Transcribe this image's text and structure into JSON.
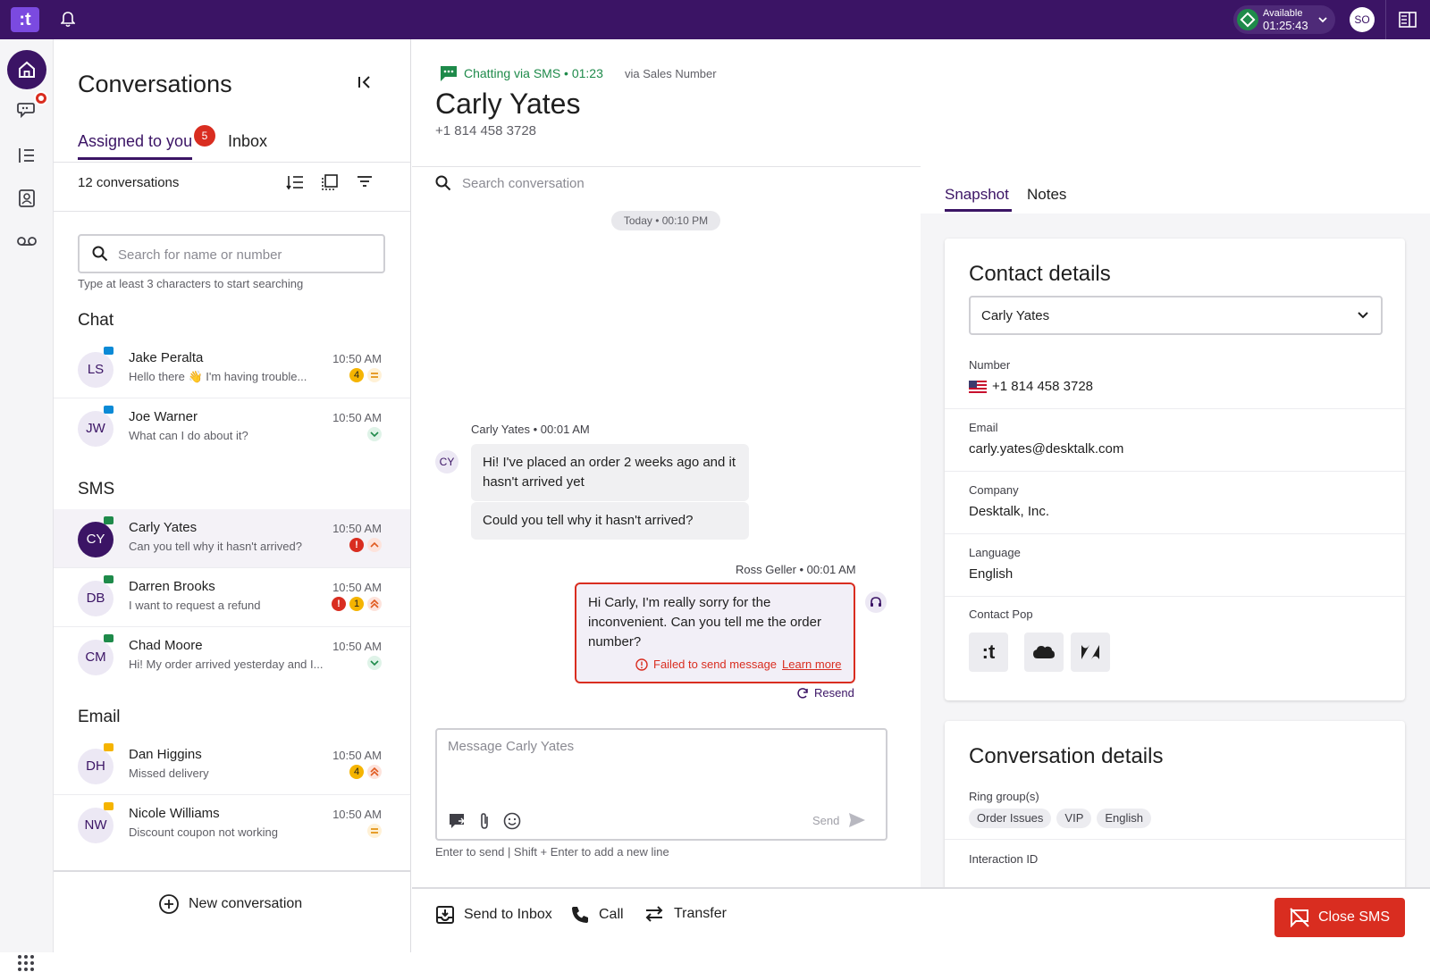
{
  "topbar": {
    "logo": ":t",
    "status": {
      "label": "Available",
      "timer": "01:25:43",
      "color": "#1e8a4a"
    },
    "user_initials": "SO",
    "brand_color": "#3b1465"
  },
  "nav": {
    "items": [
      {
        "name": "home-icon",
        "active": true
      },
      {
        "name": "conversations-icon",
        "badge": true
      },
      {
        "name": "list-icon"
      },
      {
        "name": "contacts-icon"
      },
      {
        "name": "voicemail-icon"
      }
    ]
  },
  "conversations": {
    "title": "Conversations",
    "tabs": [
      {
        "label": "Assigned to you",
        "badge": "5",
        "active": true
      },
      {
        "label": "Inbox"
      }
    ],
    "count_label": "12 conversations",
    "search": {
      "placeholder": "Search for name or number",
      "hint": "Type at least 3 characters to start searching"
    },
    "sections": [
      {
        "title": "Chat",
        "items": [
          {
            "initials": "LS",
            "name": "Jake Peralta",
            "preview": "Hello there 👋 I'm having trouble...",
            "time": "10:50 AM",
            "count": "4",
            "priority": "medium",
            "channel": "chat"
          },
          {
            "initials": "JW",
            "name": "Joe Warner",
            "preview": "What can I do about it?",
            "time": "10:50 AM",
            "priority": "low",
            "channel": "chat"
          }
        ]
      },
      {
        "title": "SMS",
        "items": [
          {
            "initials": "CY",
            "name": "Carly Yates",
            "preview": "Can you tell why it hasn't arrived?",
            "time": "10:50 AM",
            "error": "!",
            "priority": "high",
            "channel": "sms",
            "selected": true
          },
          {
            "initials": "DB",
            "name": "Darren Brooks",
            "preview": "I want to request a refund",
            "time": "10:50 AM",
            "error": "!",
            "count": "1",
            "priority": "urgent",
            "channel": "sms"
          },
          {
            "initials": "CM",
            "name": "Chad Moore",
            "preview": "Hi! My order arrived yesterday and I...",
            "time": "10:50 AM",
            "priority": "low",
            "channel": "sms"
          }
        ]
      },
      {
        "title": "Email",
        "items": [
          {
            "initials": "DH",
            "name": "Dan Higgins",
            "preview": "Missed delivery",
            "time": "10:50 AM",
            "count": "4",
            "priority": "urgent",
            "channel": "email"
          },
          {
            "initials": "NW",
            "name": "Nicole Williams",
            "preview": "Discount coupon not working",
            "time": "10:50 AM",
            "priority": "medium",
            "channel": "email"
          }
        ]
      }
    ],
    "new_conversation": "New conversation"
  },
  "chat": {
    "channel_label": "Chatting via SMS • 01:23",
    "via": "via Sales Number",
    "customer_name": "Carly Yates",
    "customer_number": "+1 814 458 3728",
    "search_placeholder": "Search conversation",
    "day_chip": "Today • 00:10 PM",
    "customer_meta": "Carly Yates • 00:01 AM",
    "customer_initials": "CY",
    "messages_in": [
      "Hi! I've placed an order 2 weeks ago and it hasn't arrived yet",
      "Could you tell why it hasn't arrived?"
    ],
    "agent_meta": "Ross Geller • 00:01 AM",
    "agent_message": "Hi Carly, I'm really sorry for the inconvenient. Can you tell me the order number?",
    "failed_label": "Failed to send message",
    "learn_more": "Learn more",
    "resend": "Resend",
    "composer_placeholder": "Message Carly Yates",
    "send_label": "Send",
    "composer_hint": "Enter to send | Shift + Enter to add a new line"
  },
  "actions": {
    "send_to_inbox": "Send to Inbox",
    "call": "Call",
    "transfer": "Transfer",
    "close": "Close SMS"
  },
  "side": {
    "tabs": [
      {
        "label": "Snapshot",
        "active": true
      },
      {
        "label": "Notes"
      }
    ],
    "contact": {
      "title": "Contact details",
      "selected_contact": "Carly Yates",
      "fields": [
        {
          "label": "Number",
          "value": "+1 814 458 3728"
        },
        {
          "label": "Email",
          "value": "carly.yates@desktalk.com"
        },
        {
          "label": "Company",
          "value": "Desktalk, Inc."
        },
        {
          "label": "Language",
          "value": "English"
        }
      ],
      "pop_label": "Contact Pop",
      "pop_apps": [
        "talkdesk-icon",
        "salesforce-icon",
        "zendesk-icon"
      ]
    },
    "conversation": {
      "title": "Conversation details",
      "ring_label": "Ring group(s)",
      "ring_groups": [
        "Order Issues",
        "VIP",
        "English"
      ],
      "interaction_label": "Interaction ID"
    }
  }
}
